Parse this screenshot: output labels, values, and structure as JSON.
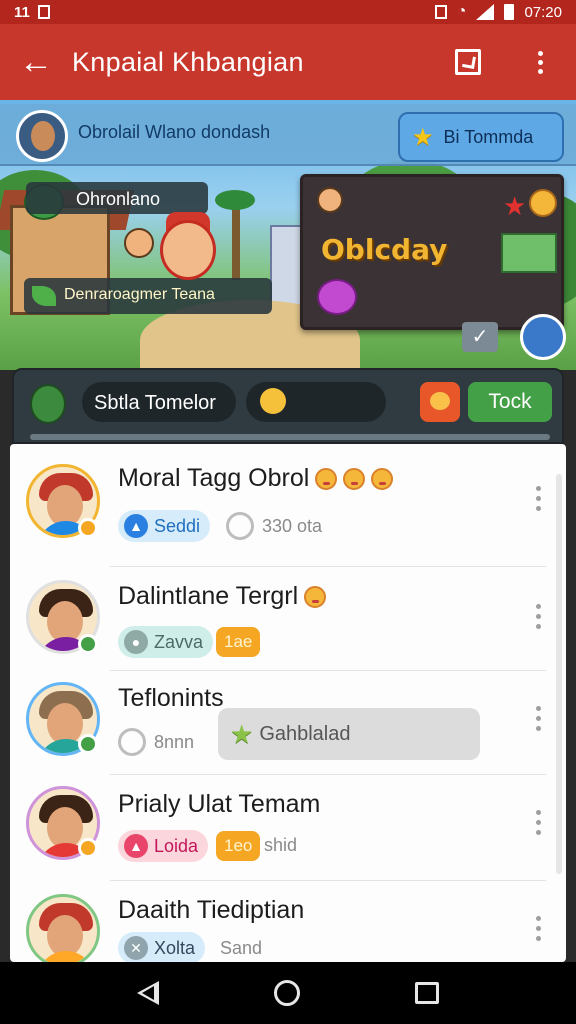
{
  "status_bar": {
    "left": "11",
    "time": "07:20"
  },
  "app_bar": {
    "title": "Knpaial Khbangian"
  },
  "scene": {
    "header_name": "Obrolail Wlano dondash",
    "header_button": "Bi Tommda",
    "chip_a": "Ohronlano",
    "chip_b": "Denraroagmer Teana",
    "panel_title": "Oblcday"
  },
  "control_bar": {
    "name": "Sbtla Tomelor",
    "action_button": "Tock"
  },
  "list": {
    "rows": [
      {
        "title": "Moral Tagg Obrol",
        "tag": "Seddi",
        "meta": "330 ota",
        "badge": ""
      },
      {
        "title": "Dalintlane Tergrl",
        "tag": "Zavva",
        "meta": "",
        "badge": "1ae"
      },
      {
        "title": "Teflonints",
        "tag": "",
        "meta": "8nnn",
        "badge": ""
      },
      {
        "title": "Prialy Ulat Temam",
        "tag": "Loida",
        "meta": "shid",
        "badge": "1eo"
      },
      {
        "title": "Daaith Tiediptian",
        "tag": "Xolta",
        "meta": "Sand",
        "badge": ""
      }
    ],
    "toast": "Gahblalad"
  },
  "colors": {
    "app_bar": "#c8372b",
    "accent_green": "#43a047",
    "accent_orange": "#f5a623",
    "tag_blue": "#d7ecfb",
    "tag_teal": "#cfeee9",
    "tag_pink": "#fbd6dc"
  },
  "icons": {
    "back": "arrow-left-icon",
    "app_action_1": "square-check-icon",
    "app_action_2": "more-vert-icon",
    "nav_back": "triangle-back-icon",
    "nav_home": "circle-home-icon",
    "nav_recents": "square-recents-icon"
  }
}
